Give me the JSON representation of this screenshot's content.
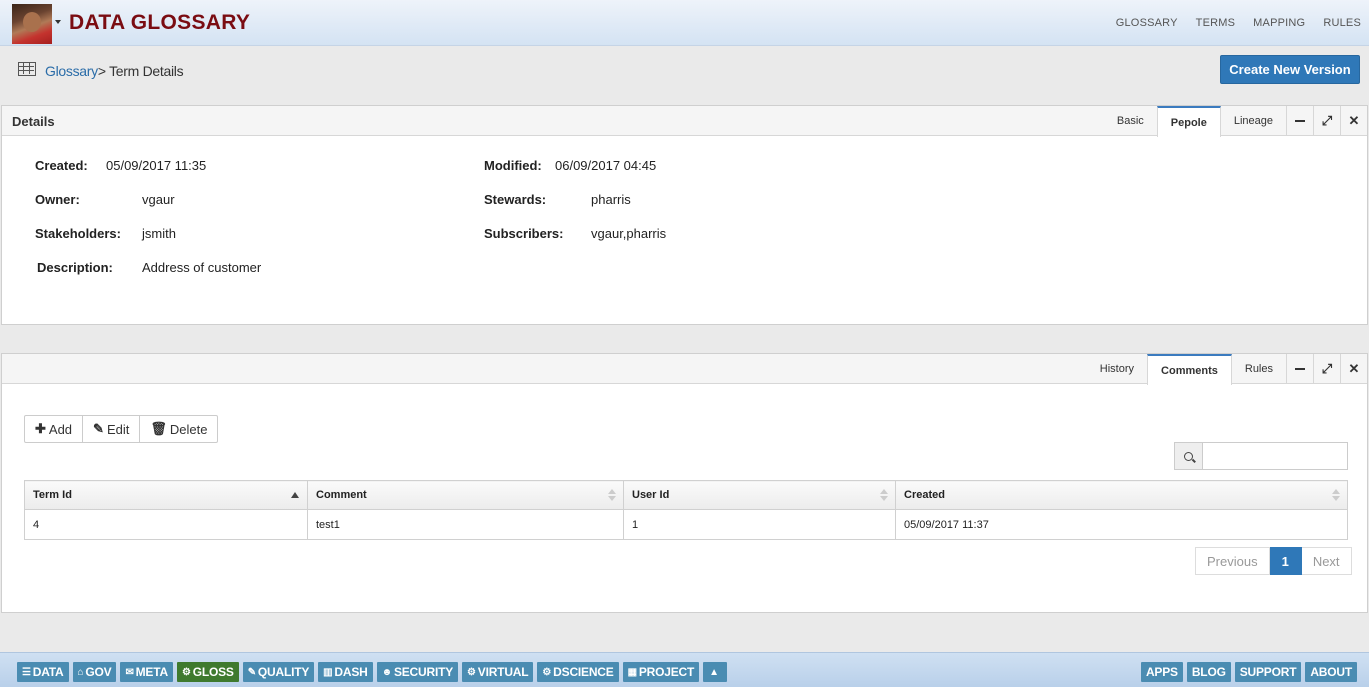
{
  "app": {
    "title": "DATA GLOSSARY",
    "nav": [
      "GLOSSARY",
      "TERMS",
      "MAPPING",
      "RULES"
    ]
  },
  "breadcrumb": {
    "link": "Glossary",
    "separator": ">",
    "current": " Term Details"
  },
  "actions": {
    "create_version": "Create New Version"
  },
  "details_panel": {
    "title": "Details",
    "tabs": [
      "Basic",
      "Pepole",
      "Lineage"
    ],
    "active_tab": "Pepole",
    "fields": {
      "created_label": "Created:",
      "created_value": "05/09/2017 11:35",
      "modified_label": "Modified:",
      "modified_value": "06/09/2017 04:45",
      "owner_label": "Owner:",
      "owner_value": "vgaur",
      "stewards_label": "Stewards:",
      "stewards_value": "pharris",
      "stakeholders_label": "Stakeholders:",
      "stakeholders_value": "jsmith",
      "subscribers_label": "Subscribers:",
      "subscribers_value": "vgaur,pharris",
      "description_label": "Description:",
      "description_value": "Address of customer"
    }
  },
  "comments_panel": {
    "tabs": [
      "History",
      "Comments",
      "Rules"
    ],
    "active_tab": "Comments",
    "toolbar": {
      "add": "Add",
      "edit": "Edit",
      "delete": "Delete"
    },
    "search": {
      "value": "",
      "placeholder": ""
    },
    "table": {
      "headers": [
        "Term Id",
        "Comment",
        "User Id",
        "Created"
      ],
      "rows": [
        [
          "4",
          "test1",
          "1",
          "05/09/2017 11:37"
        ]
      ]
    },
    "pager": {
      "previous": "Previous",
      "current": "1",
      "next": "Next"
    }
  },
  "bottom_bar": {
    "modules": [
      "DATA",
      "GOV",
      "META",
      "GLOSS",
      "QUALITY",
      "DASH",
      "SECURITY",
      "VIRTUAL",
      "DSCIENCE",
      "PROJECT"
    ],
    "active_module": "GLOSS",
    "links": [
      "APPS",
      "BLOG",
      "SUPPORT",
      "ABOUT"
    ]
  },
  "colors": {
    "title": "#7a0c12",
    "primary": "#2f78b8",
    "module": "#4a8cb2",
    "module_active": "#3f7a2e"
  }
}
